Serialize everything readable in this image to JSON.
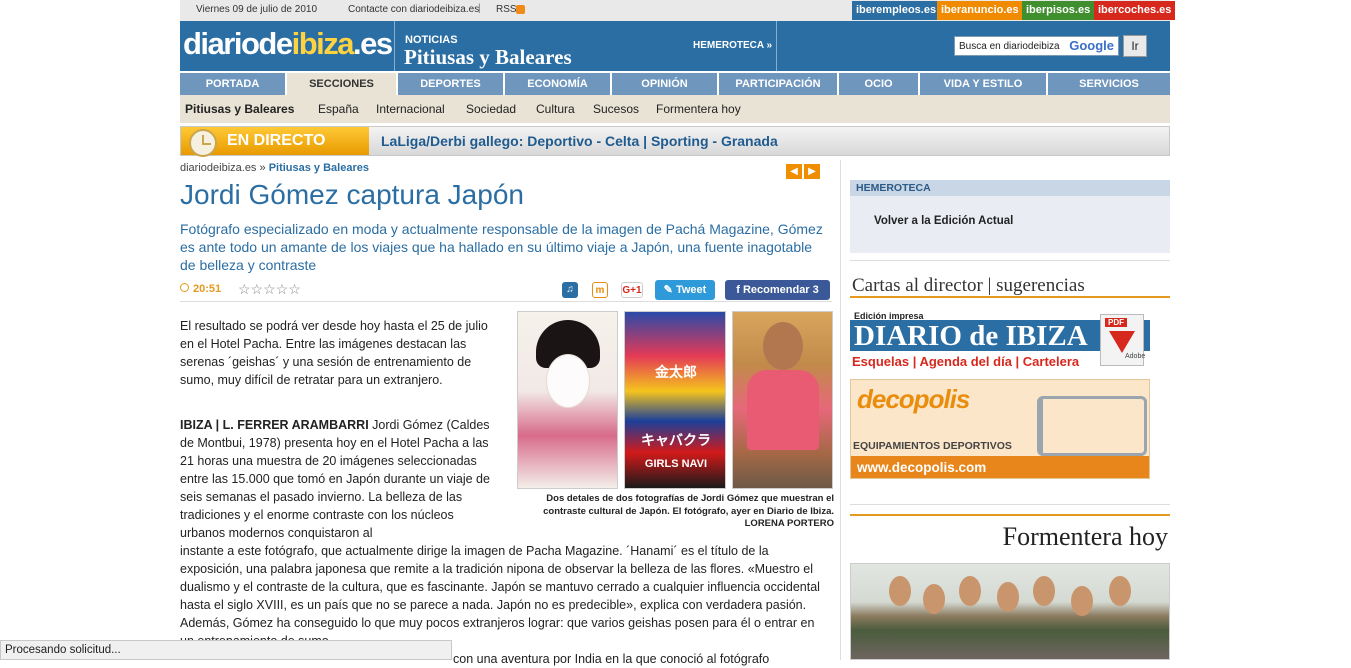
{
  "topbar": {
    "date": "Viernes 09 de julio de 2010",
    "contact": "Contacte con diariodeibiza.es",
    "separator": "|",
    "rss": "RSS",
    "iber": [
      {
        "label": "iberempleos.es",
        "color": "#2b6ea3"
      },
      {
        "label": "iberanuncio.es",
        "color": "#f08a00"
      },
      {
        "label": "iberpisos.es",
        "color": "#3f8f2f"
      },
      {
        "label": "ibercoches.es",
        "color": "#d7281d"
      }
    ]
  },
  "header": {
    "logo_main": "diariode",
    "logo_accent": "ibiza",
    "logo_suffix": ".es",
    "noticias": "NOTICIAS",
    "section_title": "Pitiusas y Baleares",
    "hemeroteca": "HEMEROTECA »",
    "search_placeholder": "Busca en diariodeibiza",
    "search_google": "Google",
    "search_button": "Ir"
  },
  "nav": {
    "items": [
      "PORTADA",
      "SECCIONES",
      "DEPORTES",
      "ECONOMÍA",
      "OPINIÓN",
      "PARTICIPACIÓN",
      "OCIO",
      "VIDA Y ESTILO",
      "SERVICIOS"
    ],
    "active": "SECCIONES",
    "subitems": [
      "Pitiusas y Baleares",
      "España",
      "Internacional",
      "Sociedad",
      "Cultura",
      "Sucesos",
      "Formentera hoy"
    ]
  },
  "live": {
    "label": "EN DIRECTO",
    "text": "LaLiga/Derbi gallego: Deportivo - Celta  | Sporting - Granada"
  },
  "article": {
    "breadcrumb_site": "diariodeibiza.es",
    "breadcrumb_sep": "»",
    "breadcrumb_section": "Pitiusas y Baleares",
    "prev_icon": "arrow-left-icon",
    "next_icon": "arrow-right-icon",
    "title": "Jordi Gómez captura Japón",
    "lead": "Fotógrafo especializado en moda y actualmente responsable de la imagen de Pachá Magazine, Gómez es ante todo un amante de los viajes que ha hallado en su último viaje a Japón, una fuente inagotable de belleza y contraste",
    "time": "20:51",
    "stars": "☆☆☆☆☆",
    "gplus": "G+1",
    "tweet": "Tweet",
    "recommend": "Recomendar 3",
    "p1": "El resultado se podrá ver desde hoy hasta el 25 de julio en el Hotel Pacha. Entre las imágenes destacan las serenas ´geishas´ y una sesión de entrenamiento de sumo, muy difícil de retratar para un extranjero.",
    "p2_byline": "IBIZA | L. FERRER ARAMBARRI",
    "p2": " Jordi Gómez (Caldes de Montbui, 1978) presenta hoy en el Hotel Pacha a las 21 horas una muestra de 20 imágenes seleccionadas entre las 15.000 que tomó en Japón durante un viaje de seis semanas el pasado invierno. La belleza de las tradiciones y el enorme contraste con los núcleos urbanos modernos conquistaron al",
    "p3": "instante a este fotógrafo, que actualmente dirige la imagen de Pacha Magazine. ´Hanami´ es el título de la exposición, una palabra japonesa que remite a la tradición nipona de observar la belleza de las flores. «Muestro el dualismo y el contraste de la cultura, que es fascinante. Japón se mantuvo cerrado a cualquier influencia occidental hasta el siglo XVIII, es un país que no se parece a nada. Japón no es predecible», explica con verdadera pasión. Además, Gómez ha conseguido lo que muy pocos extranjeros lograr: que varios geishas posen para él o entrar en un entrenamiento de sumo.",
    "p4": "con una aventura por India en la que conoció al fotógrafo",
    "photo_sign_1": "金太郎",
    "photo_sign_2": "キャバクラ",
    "photo_sign_3": "GIRLS NAVI",
    "caption": "Dos detales de dos fotografías de Jordi Gómez que muestran el contraste cultural de Japón. El fotógrafo, ayer en Diario de Ibiza.",
    "caption_credit": "LORENA PORTERO"
  },
  "sidebar": {
    "hemeroteca_title": "HEMEROTECA",
    "hemeroteca_link": "Volver a la Edición Actual",
    "cartas": "Cartas al director | sugerencias",
    "edicion": "Edición impresa",
    "di_name": "DIARIO de IBIZA",
    "di_links": "Esquelas | Agenda del día | Cartelera",
    "pdf_tag": "PDF",
    "pdf_adobe": "Adobe",
    "deco_logo": "decopolis",
    "deco_tagline": "EQUIPAMIENTOS DEPORTIVOS",
    "deco_url": "www.decopolis.com",
    "formentera": "Formentera hoy"
  },
  "status": {
    "text": "Procesando solicitud..."
  }
}
